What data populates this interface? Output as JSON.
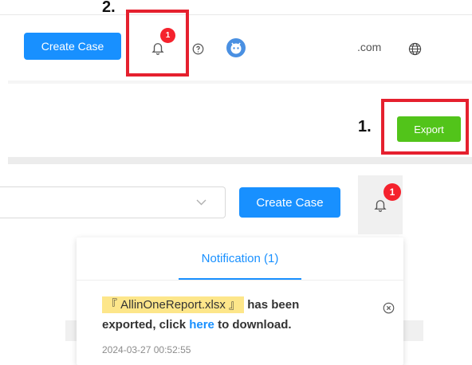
{
  "annotations": {
    "step1": "1.",
    "step2": "2."
  },
  "top_toolbar": {
    "create_case_label": "Create Case",
    "notification_count": "1",
    "email_suffix": ".com"
  },
  "export": {
    "label": "Export"
  },
  "bottom_toolbar": {
    "create_case_label": "Create Case",
    "notification_count": "1"
  },
  "notification_panel": {
    "title": "Notification (1)",
    "message": {
      "file_name": "『 AllinOneReport.xlsx 』",
      "text_before_link": " has been exported, click ",
      "link_text": "here",
      "text_after_link": " to download."
    },
    "timestamp": "2024-03-27 00:52:55"
  },
  "colors": {
    "primary": "#1890ff",
    "export_green": "#52c41a",
    "badge_red": "#f5222d",
    "annotation_red": "#e5202e",
    "highlight_yellow": "#fde68a"
  }
}
